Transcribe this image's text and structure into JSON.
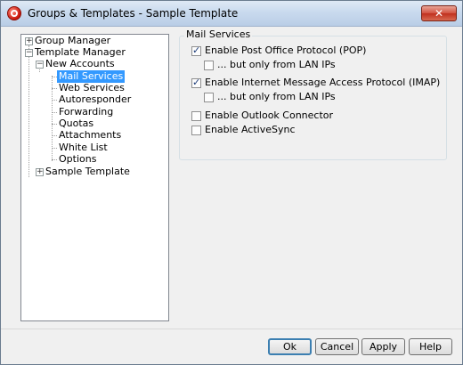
{
  "window": {
    "title": "Groups & Templates - Sample Template",
    "close_label": "✕"
  },
  "tree": {
    "items": [
      {
        "label": "Group Manager",
        "expander": "+"
      },
      {
        "label": "Template Manager",
        "expander": "−"
      },
      {
        "label": "New Accounts",
        "expander": "−"
      },
      {
        "label": "Mail Services",
        "selected": true
      },
      {
        "label": "Web Services"
      },
      {
        "label": "Autoresponder"
      },
      {
        "label": "Forwarding"
      },
      {
        "label": "Quotas"
      },
      {
        "label": "Attachments"
      },
      {
        "label": "White List"
      },
      {
        "label": "Options"
      },
      {
        "label": "Sample Template",
        "expander": "+"
      }
    ]
  },
  "mail_services": {
    "group_label": "Mail Services",
    "options": [
      {
        "label": "Enable Post Office Protocol (POP)",
        "checked": true
      },
      {
        "label": "... but only from LAN IPs",
        "checked": false
      },
      {
        "label": "Enable Internet Message Access Protocol (IMAP)",
        "checked": true
      },
      {
        "label": "... but only from LAN IPs",
        "checked": false
      },
      {
        "label": "Enable Outlook Connector",
        "checked": false
      },
      {
        "label": "Enable ActiveSync",
        "checked": false
      }
    ]
  },
  "buttons": {
    "ok": "Ok",
    "cancel": "Cancel",
    "apply": "Apply",
    "help": "Help"
  }
}
